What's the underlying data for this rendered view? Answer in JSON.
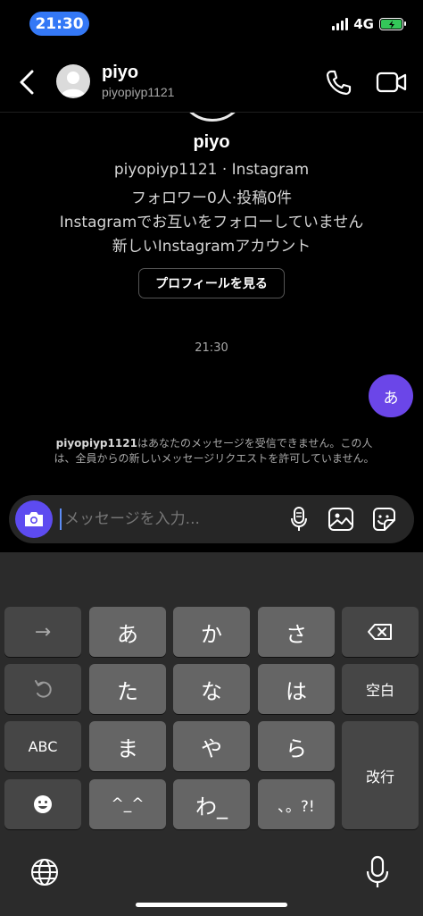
{
  "status_bar": {
    "time": "21:30",
    "network": "4G"
  },
  "header": {
    "name": "piyo",
    "username": "piyopiyp1121"
  },
  "profile": {
    "name": "piyo",
    "line1": "piyopiyp1121 · Instagram",
    "line2": "フォロワー0人·投稿0件",
    "line3": "Instagramでお互いをフォローしていません",
    "line4": "新しいInstagramアカウント",
    "view_profile_label": "プロフィールを見る"
  },
  "thread": {
    "time": "21:30",
    "sent_message": "あ",
    "notice_user": "piyopiyp1121",
    "notice_text": "はあなたのメッセージを受信できません。この人は、全員からの新しいメッセージリクエストを許可していません。"
  },
  "composer": {
    "placeholder": "メッセージを入力..."
  },
  "keyboard": {
    "row1": [
      "→",
      "あ",
      "か",
      "さ"
    ],
    "row2": [
      "た",
      "な",
      "は"
    ],
    "space_label": "空白",
    "row3": [
      "ABC",
      "ま",
      "や",
      "ら"
    ],
    "return_label": "改行",
    "row4": [
      "^_^",
      "わ_",
      "､。?!"
    ]
  },
  "colors": {
    "accent": "#6b46e8",
    "status_pill": "#3478f6",
    "battery": "#34c759"
  }
}
